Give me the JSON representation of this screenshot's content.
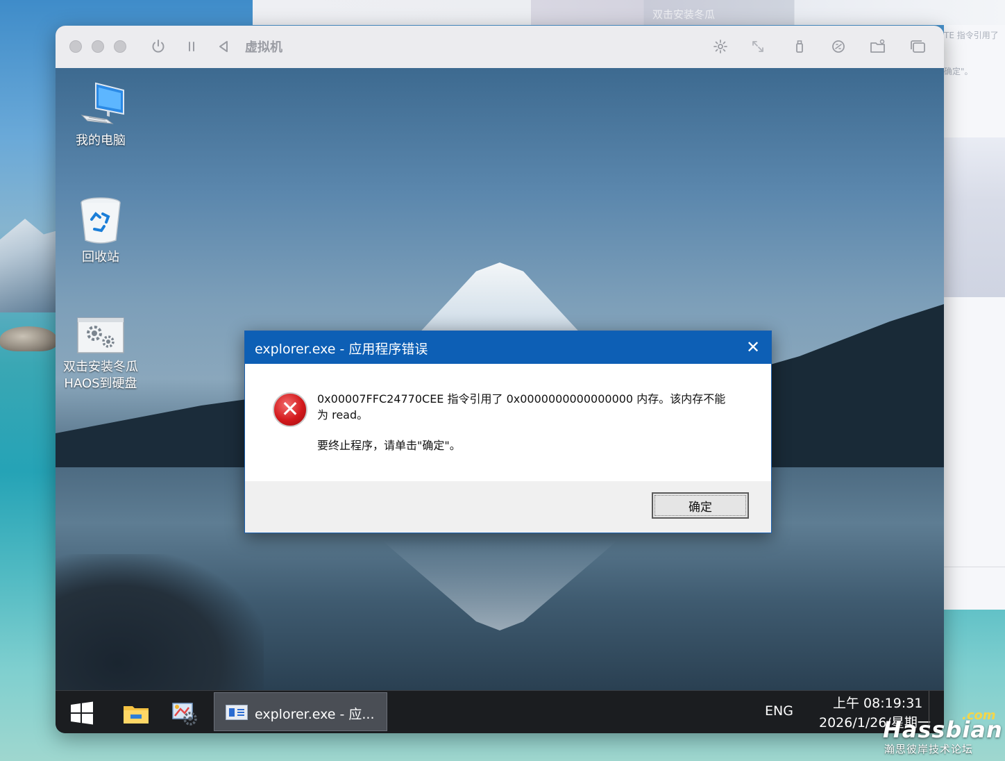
{
  "host": {
    "bg_window_ghost_title": "双击安装冬瓜",
    "bg_right_ghost_1": "TE 指令引用了",
    "bg_right_ghost_2": "确定\"。"
  },
  "vm": {
    "title": "虚拟机",
    "toolbar_icons": [
      "power-icon",
      "pause-icon",
      "back-icon",
      "brightness-icon",
      "resize-icon",
      "usb-icon",
      "network-icon",
      "folder-icon",
      "window-icon"
    ]
  },
  "desktop": {
    "icons": [
      {
        "label": "我的电脑"
      },
      {
        "label": "回收站"
      },
      {
        "label_line1": "双击安装冬瓜",
        "label_line2": "HAOS到硬盘"
      }
    ]
  },
  "dialog": {
    "title": "explorer.exe - 应用程序错误",
    "message_line1": "0x00007FFC24770CEE 指令引用了 0x0000000000000000 内存。该内存不能",
    "message_line2": "为 read。",
    "message_line3": "要终止程序，请单击\"确定\"。",
    "ok_label": "确定"
  },
  "taskbar": {
    "app_label": "explorer.exe - 应...",
    "lang": "ENG",
    "time": "上午 08:19:31",
    "date": "2026/1/26/星期一"
  },
  "watermark": {
    "com": ".com",
    "brand": "Hassbian",
    "sub": "瀚思彼岸技术论坛"
  },
  "colors": {
    "dialog_title_bg": "#0d5fb5",
    "error_red": "#d3191c",
    "taskbar_bg": "#1b1d20"
  }
}
